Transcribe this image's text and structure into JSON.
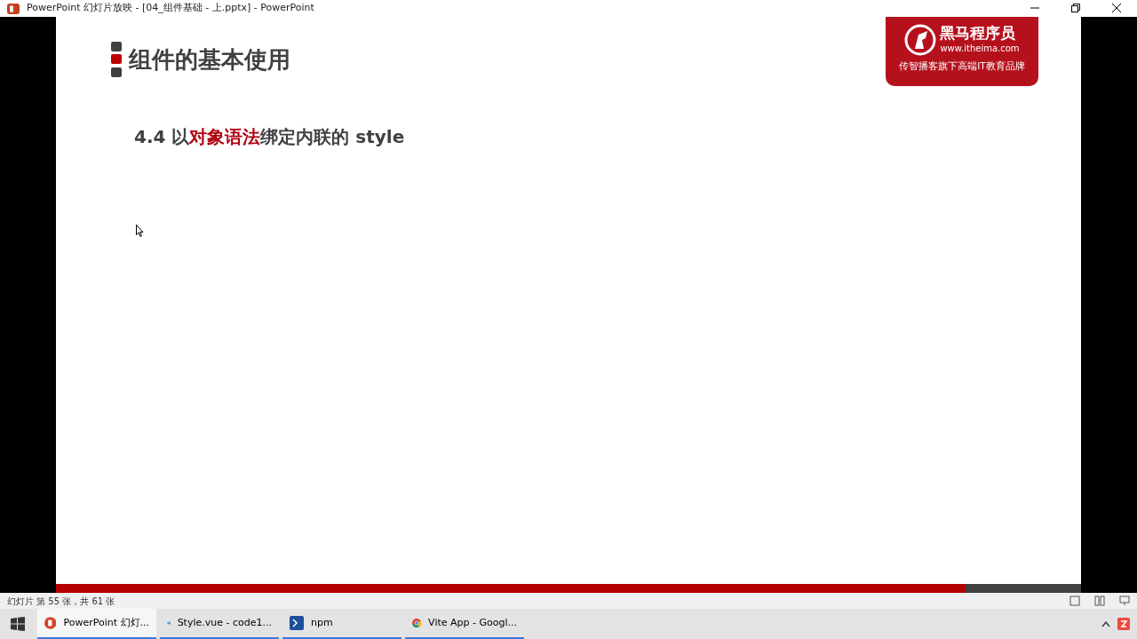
{
  "window": {
    "title": "PowerPoint 幻灯片放映 - [04_组件基础 - 上.pptx] - PowerPoint"
  },
  "slide": {
    "title": "组件的基本使用",
    "heading": [
      {
        "text": "4.4 以",
        "highlight": false
      },
      {
        "text": "对象语法",
        "highlight": true
      },
      {
        "text": "绑定内联的 style",
        "highlight": false
      }
    ],
    "logo": {
      "name": "黑马程序员",
      "url": "www.itheima.com",
      "tagline": "传智播客旗下高端IT教育品牌"
    }
  },
  "status_bar": {
    "text": "幻灯片 第 55 张，共 61 张"
  },
  "taskbar": {
    "items": [
      {
        "label": "PowerPoint 幻灯...",
        "kind": "powerpoint",
        "selected": true
      },
      {
        "label": "Style.vue - code1...",
        "kind": "vscode",
        "selected": false
      },
      {
        "label": "npm",
        "kind": "terminal",
        "selected": false
      },
      {
        "label": "Vite App - Googl...",
        "kind": "chrome",
        "selected": false
      }
    ]
  }
}
